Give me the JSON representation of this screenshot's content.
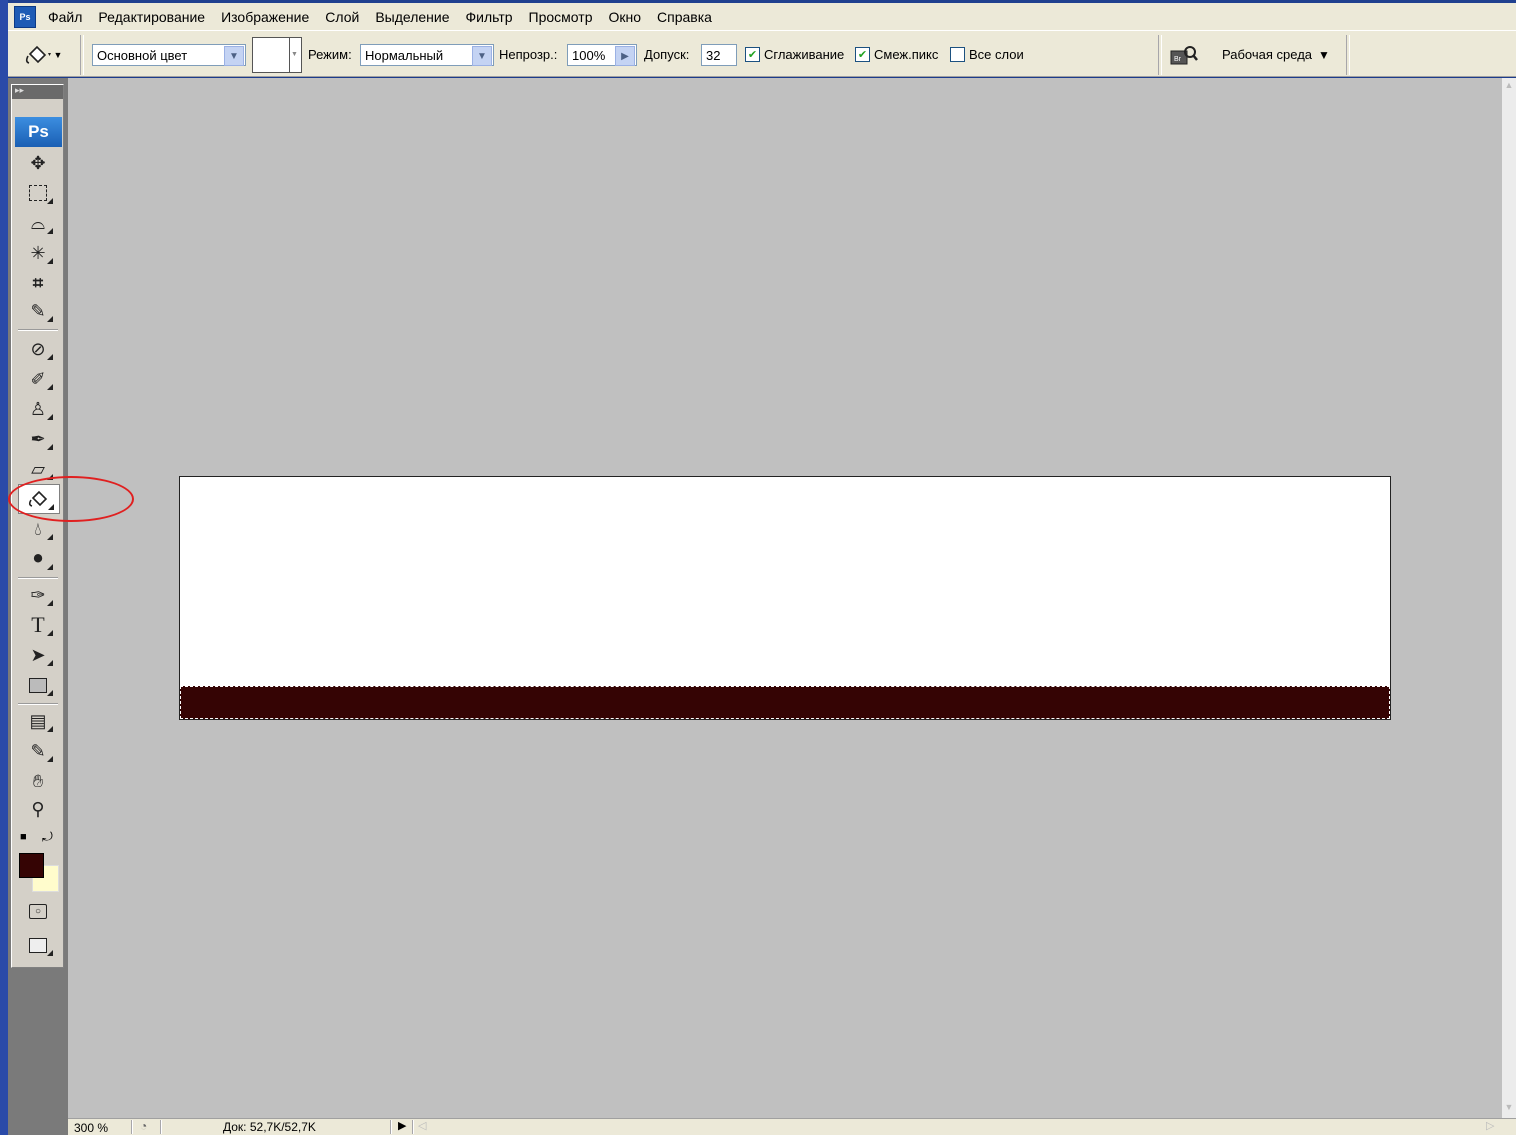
{
  "app": {
    "logo": "Ps"
  },
  "menu": [
    "Файл",
    "Редактирование",
    "Изображение",
    "Слой",
    "Выделение",
    "Фильтр",
    "Просмотр",
    "Окно",
    "Справка"
  ],
  "options": {
    "fill_source": "Основной цвет",
    "mode_label": "Режим:",
    "mode_value": "Нормальный",
    "opacity_label": "Непрозр.:",
    "opacity_value": "100%",
    "tolerance_label": "Допуск:",
    "tolerance_value": "32",
    "antialias_label": "Сглаживание",
    "antialias_checked": true,
    "contiguous_label": "Смеж.пикс",
    "contiguous_checked": true,
    "all_layers_label": "Все слои",
    "all_layers_checked": false,
    "workspace_label": "Рабочая среда"
  },
  "toolbox": {
    "badge": "Ps",
    "active_tool": "paint-bucket",
    "foreground_color": "#350404",
    "background_color": "#fffccc"
  },
  "canvas": {
    "fill_color": "#350404",
    "base_color": "#ffffff"
  },
  "status": {
    "zoom": "300 %",
    "doc": "Док: 52,7K/52,7K"
  },
  "annotation": {
    "color": "#e02020"
  }
}
